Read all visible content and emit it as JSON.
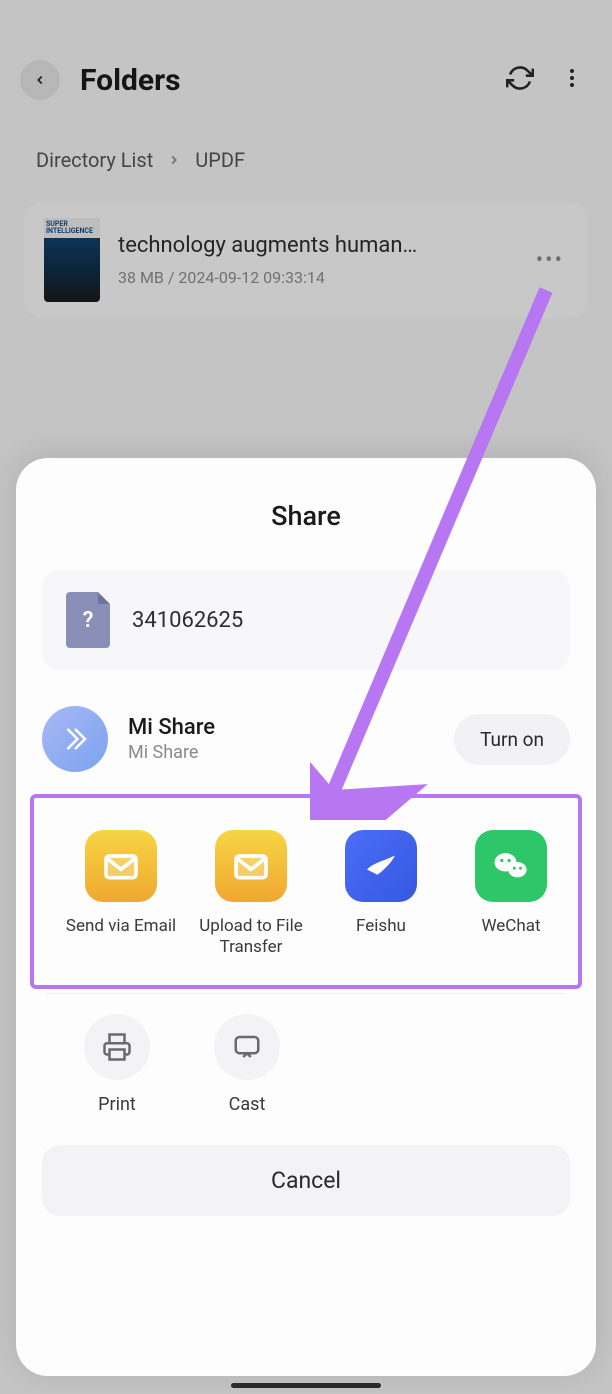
{
  "header": {
    "title": "Folders"
  },
  "breadcrumb": {
    "item1": "Directory List",
    "item2": "UPDF"
  },
  "file": {
    "thumb_label": "SUPER INTELLIGENCE",
    "name": "technology augments human…",
    "meta": "38 MB / 2024-09-12 09:33:14"
  },
  "share": {
    "title": "Share",
    "file_question": "?",
    "file_name": "341062625",
    "mi_share": {
      "title": "Mi Share",
      "subtitle": "Mi Share",
      "button": "Turn on"
    },
    "apps": {
      "email": "Send via Email",
      "upload": "Upload to File Transfer",
      "feishu": "Feishu",
      "wechat": "WeChat"
    },
    "actions": {
      "print": "Print",
      "cast": "Cast"
    },
    "cancel": "Cancel"
  }
}
